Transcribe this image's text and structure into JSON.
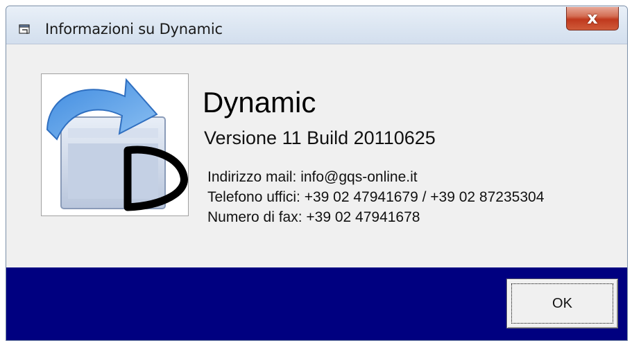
{
  "window": {
    "title": "Informazioni su Dynamic",
    "close_label": "x"
  },
  "about": {
    "app_name": "Dynamic",
    "version": "Versione 11 Build 20110625",
    "email_line": "Indirizzo mail: info@gqs-online.it",
    "phone_line": "Telefono uffici: +39 02 47941679 / +39 02 87235304",
    "fax_line": "Numero di fax: +39 02 47941678"
  },
  "buttons": {
    "ok_label": "OK"
  },
  "colors": {
    "footer_band": "#000080",
    "client_bg": "#f0f0f0",
    "close_red": "#c0391d"
  },
  "icons": {
    "title": "app-window-icon",
    "logo": "dynamic-logo-icon"
  }
}
